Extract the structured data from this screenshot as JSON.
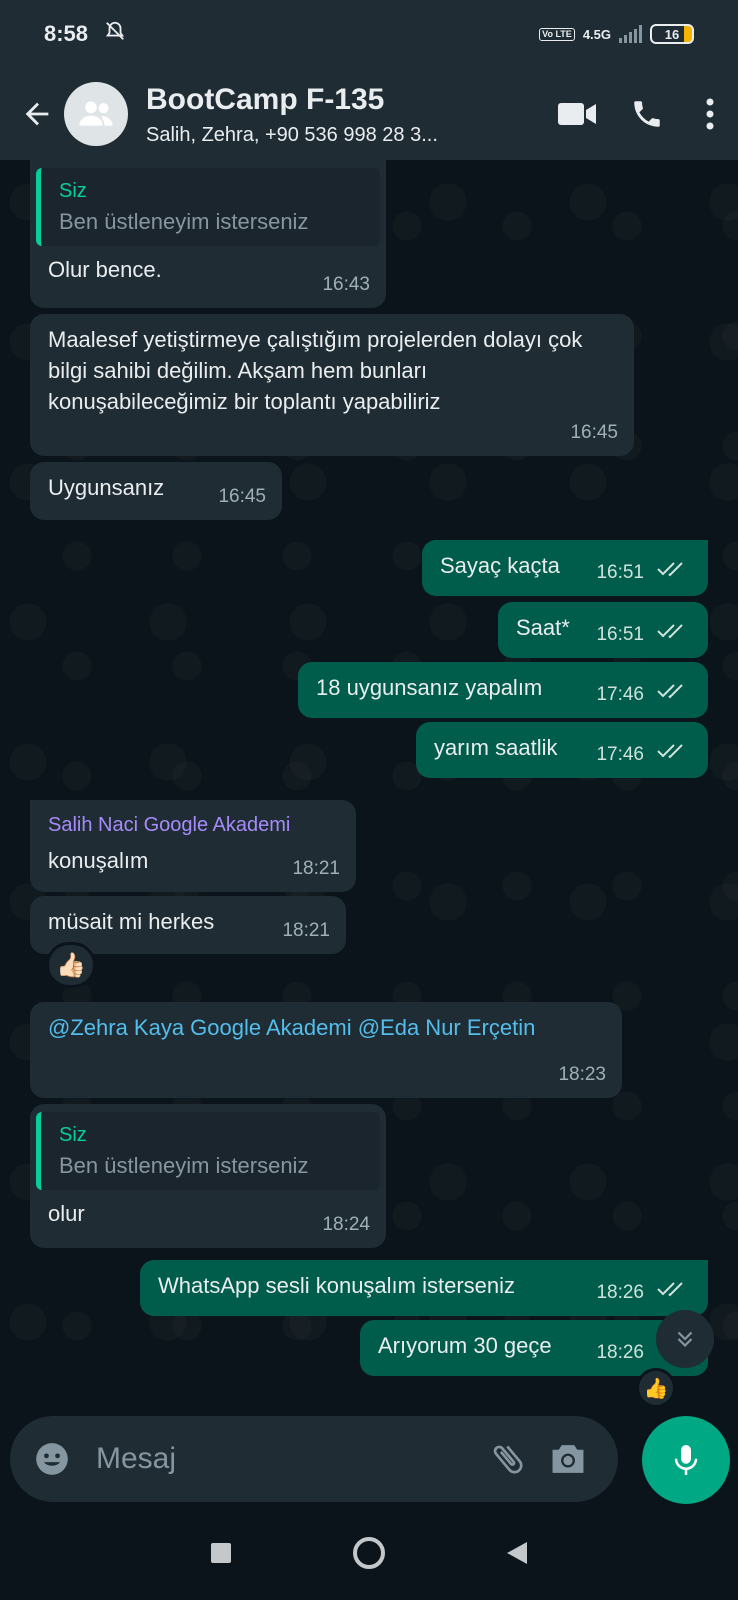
{
  "status_bar": {
    "time": "8:58",
    "network": "4.5G",
    "volte": "Vo LTE",
    "battery": "16"
  },
  "header": {
    "title": "BootCamp F-135",
    "subtitle": "Salih, Zehra, +90 536 998 28 3..."
  },
  "messages": [
    {
      "dir": "in",
      "quote_author": "Siz",
      "quote_text": "Ben üstleneyim isterseniz",
      "text": "Olur bence.",
      "time": "16:43"
    },
    {
      "dir": "in",
      "text": "Maalesef yetiştirmeye çalıştığım projelerden dolayı çok bilgi sahibi değilim. Akşam hem bunları konuşabileceğimiz bir toplantı yapabiliriz",
      "time": "16:45"
    },
    {
      "dir": "in",
      "text": "Uygunsanız",
      "time": "16:45"
    },
    {
      "dir": "out",
      "text": "Sayaç kaçta",
      "time": "16:51"
    },
    {
      "dir": "out",
      "text": "Saat*",
      "time": "16:51"
    },
    {
      "dir": "out",
      "text": "18 uygunsanız yapalım",
      "time": "17:46"
    },
    {
      "dir": "out",
      "text": "yarım saatlik",
      "time": "17:46"
    },
    {
      "dir": "in",
      "sender": "Salih Naci Google Akademi",
      "text": "konuşalım",
      "time": "18:21"
    },
    {
      "dir": "in",
      "text": "müsait mi herkes",
      "time": "18:21",
      "reaction": "👍🏻"
    },
    {
      "dir": "in",
      "text": "@Zehra Kaya Google Akademi @Eda Nur Erçetin",
      "time": "18:23"
    },
    {
      "dir": "in",
      "quote_author": "Siz",
      "quote_text": "Ben üstleneyim isterseniz",
      "text": "olur",
      "time": "18:24"
    },
    {
      "dir": "out",
      "text": "WhatsApp sesli konuşalım isterseniz",
      "time": "18:26"
    },
    {
      "dir": "out",
      "text": "Arıyorum 30 geçe",
      "time": "18:26",
      "reaction": "👍"
    }
  ],
  "input": {
    "placeholder": "Mesaj"
  },
  "icons": {
    "back": "arrow-left-icon",
    "video": "video-call-icon",
    "phone": "phone-icon",
    "menu": "more-vert-icon",
    "emoji": "emoji-icon",
    "attach": "paperclip-icon",
    "camera": "camera-icon",
    "mic": "mic-icon",
    "scroll": "chevrons-down-icon"
  },
  "colors": {
    "header_bg": "#1f2c34",
    "incoming_bubble": "#1f2c34",
    "outgoing_bubble": "#005c4b",
    "accent": "#00a884",
    "mention": "#53bdeb",
    "sender_name": "#a78bfa"
  }
}
